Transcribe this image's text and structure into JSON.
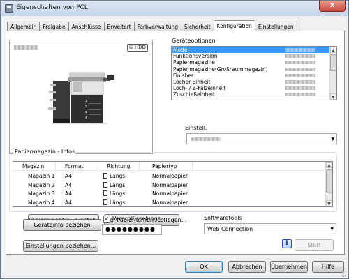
{
  "window": {
    "title": "Eigenschaften von PCL",
    "close_label": "x"
  },
  "tabs": [
    {
      "label": "Allgemein"
    },
    {
      "label": "Freigabe"
    },
    {
      "label": "Anschlüsse"
    },
    {
      "label": "Erweitert"
    },
    {
      "label": "Farbverwaltung"
    },
    {
      "label": "Sicherheit"
    },
    {
      "label": "Konfiguration",
      "active": true
    },
    {
      "label": "Einstellungen"
    }
  ],
  "preview": {
    "hdd_badge": "HDD"
  },
  "device_options": {
    "label": "Geräteoptionen",
    "items": [
      "Model",
      "Funktionsversion",
      "Papiermagazine",
      "Papiermagazine(Großraummagazin)",
      "Finisher",
      "Locher-Einheit",
      "Loch- / Z-Falzeinheit",
      "Zuschießeinheit"
    ],
    "selected_index": 0
  },
  "einstell": {
    "label": "Einstell."
  },
  "paper_tray_info": {
    "label": "Papiermagazin - Infos",
    "columns": [
      "Magazin",
      "Format",
      "Richtung",
      "Papiertyp"
    ],
    "rows": [
      {
        "magazin": "Magazin 1",
        "format": "A4",
        "richtung": "Längs",
        "papiertyp": "Normalpapier"
      },
      {
        "magazin": "Magazin 2",
        "format": "A4",
        "richtung": "Längs",
        "papiertyp": "Normalpapier"
      },
      {
        "magazin": "Magazin 3",
        "format": "A4",
        "richtung": "Längs",
        "papiertyp": "Normalpapier"
      },
      {
        "magazin": "Magazin 4",
        "format": "A4",
        "richtung": "Längs",
        "papiertyp": "Normalpapier"
      }
    ]
  },
  "buttons": {
    "paper_tray_settings": "Papiermagazin - Einstell...",
    "paper_names": "Eig. Papiernamen festlegen...",
    "get_device_info": "Geräteinfo beziehen",
    "get_settings": "Einstellungen beziehen...",
    "start": "Start",
    "ok": "OK",
    "cancel": "Abbrechen",
    "apply": "Übernehmen",
    "help": "Hilfe"
  },
  "encryption": {
    "label": "Verschlüsselungs",
    "checked": true,
    "password": "●●●●●●●●●"
  },
  "software_tools": {
    "label": "Softwaretools",
    "selected": "Web Connection"
  }
}
